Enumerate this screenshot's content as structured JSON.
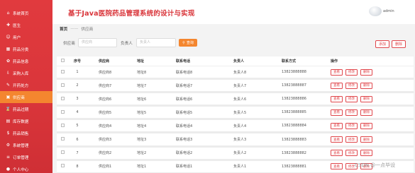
{
  "app": {
    "title": "基于Java医院药品管理系统的设计与实现",
    "user_name": "admin",
    "watermark": "CSDN @一点毕设"
  },
  "sidebar": {
    "items": [
      {
        "label": "系统首页",
        "icon": "home-icon",
        "active": false
      },
      {
        "label": "医生",
        "icon": "doctor-icon",
        "active": false
      },
      {
        "label": "用户",
        "icon": "user-icon",
        "active": false
      },
      {
        "label": "药品分类",
        "icon": "category-icon",
        "active": false
      },
      {
        "label": "药品信息",
        "icon": "medicine-icon",
        "active": false
      },
      {
        "label": "采购入库",
        "icon": "purchase-icon",
        "active": false
      },
      {
        "label": "开药处方",
        "icon": "prescription-icon",
        "active": false
      },
      {
        "label": "供应商",
        "icon": "supplier-icon",
        "active": true
      },
      {
        "label": "药品过期",
        "icon": "expired-icon",
        "active": false
      },
      {
        "label": "库存数据",
        "icon": "stock-icon",
        "active": false
      },
      {
        "label": "药品销售",
        "icon": "sales-icon",
        "active": false
      },
      {
        "label": "系统管理",
        "icon": "settings-icon",
        "active": false
      },
      {
        "label": "订单管理",
        "icon": "order-icon",
        "active": false
      },
      {
        "label": "个人中心",
        "icon": "profile-icon",
        "active": false
      }
    ]
  },
  "breadcrumb": {
    "home": "首页",
    "sep": "——",
    "current": "供应商"
  },
  "search": {
    "name_label": "供应商",
    "name_placeholder": "供应商",
    "contact_label": "负责人",
    "contact_placeholder": "负责人",
    "query_button": "查询",
    "add_button": "添加",
    "delete_button": "删除"
  },
  "table": {
    "headers": [
      "序号",
      "供应商",
      "地址",
      "联系电话",
      "负责人",
      "联系方式",
      "操作"
    ],
    "op_labels": [
      "查看",
      "修改",
      "删除"
    ],
    "rows": [
      {
        "idx": "1",
        "name": "供应商8",
        "addr": "地址8",
        "tel": "联系电话8",
        "contact": "负责人8",
        "phone": "13823888888"
      },
      {
        "idx": "2",
        "name": "供应商7",
        "addr": "地址7",
        "tel": "联系电话7",
        "contact": "负责人7",
        "phone": "13823888887"
      },
      {
        "idx": "3",
        "name": "供应商6",
        "addr": "地址6",
        "tel": "联系电话6",
        "contact": "负责人6",
        "phone": "13823888886"
      },
      {
        "idx": "4",
        "name": "供应商5",
        "addr": "地址5",
        "tel": "联系电话5",
        "contact": "负责人5",
        "phone": "13823888885"
      },
      {
        "idx": "5",
        "name": "供应商4",
        "addr": "地址4",
        "tel": "联系电话4",
        "contact": "负责人4",
        "phone": "13823888884"
      },
      {
        "idx": "6",
        "name": "供应商3",
        "addr": "地址3",
        "tel": "联系电话3",
        "contact": "负责人3",
        "phone": "13823888883"
      },
      {
        "idx": "7",
        "name": "供应商2",
        "addr": "地址2",
        "tel": "联系电话2",
        "contact": "负责人2",
        "phone": "13823888882"
      },
      {
        "idx": "8",
        "name": "供应商1",
        "addr": "地址1",
        "tel": "联系电话1",
        "contact": "负责人1",
        "phone": "13823888881"
      }
    ]
  },
  "colors": {
    "primary": "#d9353a",
    "accent": "#f4862f"
  }
}
